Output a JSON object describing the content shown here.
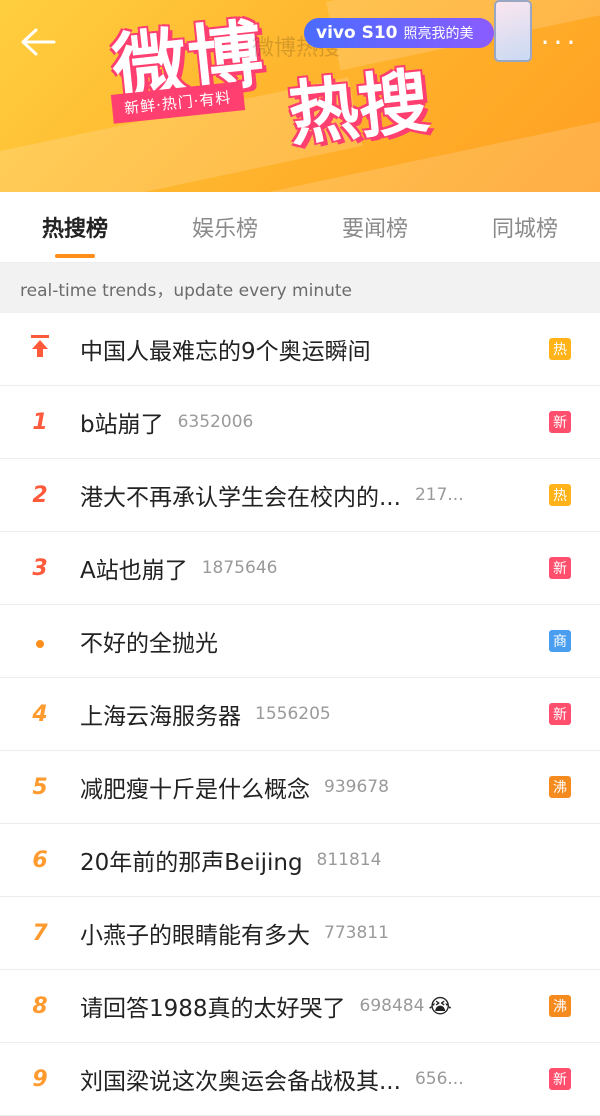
{
  "banner": {
    "logo_weibo": "微博",
    "logo_resou": "热搜",
    "slogan": "新鲜·热门·有料",
    "watermark": "微博热搜",
    "ad_brand": "vivo S10",
    "ad_text": "照亮我的美",
    "more": "···"
  },
  "tabs": [
    {
      "label": "热搜榜",
      "active": true
    },
    {
      "label": "娱乐榜",
      "active": false
    },
    {
      "label": "要闻榜",
      "active": false
    },
    {
      "label": "同城榜",
      "active": false
    }
  ],
  "subheader": "real-time trends，update every minute",
  "colors": {
    "accent": "#ff8d1a",
    "badge_hot": "#ffb319",
    "badge_new": "#ff4f6c",
    "badge_ad": "#4a9ef0",
    "badge_boil": "#f58b1f"
  },
  "rows": [
    {
      "rank": "↑",
      "rank_icon": "pin-top-icon",
      "title": "中国人最难忘的9个奥运瞬间",
      "count": "",
      "badge": "热",
      "badge_type": "hot"
    },
    {
      "rank": "1",
      "title": "b站崩了",
      "count": "6352006",
      "badge": "新",
      "badge_type": "new"
    },
    {
      "rank": "2",
      "title": "港大不再承认学生会在校内的...",
      "count": "217...",
      "badge": "热",
      "badge_type": "hot"
    },
    {
      "rank": "3",
      "title": "A站也崩了",
      "count": "1875646",
      "badge": "新",
      "badge_type": "new"
    },
    {
      "rank": "•",
      "rank_icon": "dot-icon",
      "title": "不好的全抛光",
      "count": "",
      "badge": "商",
      "badge_type": "ad"
    },
    {
      "rank": "4",
      "title": "上海云海服务器",
      "count": "1556205",
      "badge": "新",
      "badge_type": "new"
    },
    {
      "rank": "5",
      "title": "减肥瘦十斤是什么概念",
      "count": "939678",
      "badge": "沸",
      "badge_type": "boil"
    },
    {
      "rank": "6",
      "title": "20年前的那声Beijing",
      "count": "811814",
      "badge": "",
      "badge_type": ""
    },
    {
      "rank": "7",
      "title": "小燕子的眼睛能有多大",
      "count": "773811",
      "badge": "",
      "badge_type": ""
    },
    {
      "rank": "8",
      "title": "请回答1988真的太好哭了",
      "count": "698484",
      "emoji": "😭",
      "badge": "沸",
      "badge_type": "boil"
    },
    {
      "rank": "9",
      "title": "刘国梁说这次奥运会备战极其...",
      "count": "656...",
      "badge": "新",
      "badge_type": "new"
    }
  ]
}
